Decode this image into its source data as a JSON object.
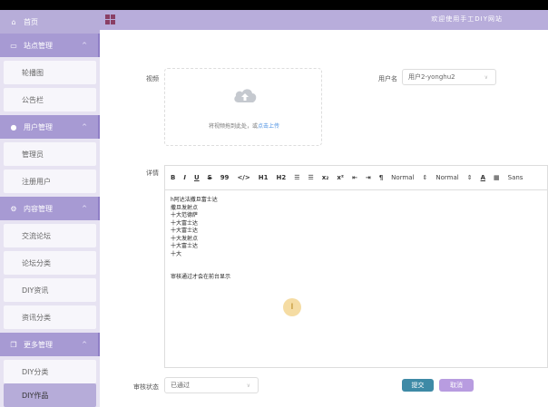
{
  "header": {
    "title": "欢迎使用手工DIY网站",
    "menu_icon": "grid-menu-icon"
  },
  "sidebar": {
    "home": {
      "label": "首页",
      "icon": "home-icon"
    },
    "groups": [
      {
        "label": "站点管理",
        "icon": "monitor-icon",
        "items": [
          "轮播图",
          "公告栏"
        ]
      },
      {
        "label": "用户管理",
        "icon": "user-icon",
        "items": [
          "管理员",
          "注册用户"
        ]
      },
      {
        "label": "内容管理",
        "icon": "gear-icon",
        "items": [
          "交流论坛",
          "论坛分类",
          "DIY资讯",
          "资讯分类"
        ]
      },
      {
        "label": "更多管理",
        "icon": "stack-icon",
        "items": [
          "DIY分类",
          "DIY作品"
        ]
      }
    ],
    "active_item": "DIY作品"
  },
  "form": {
    "video_label": "视频",
    "upload_text": "将视频拖到此处，或",
    "upload_link": "点击上传",
    "username_label": "用户名",
    "username_value": "用户2-yonghu2",
    "detail_label": "详情",
    "audit_label": "审核状态",
    "audit_value": "已通过",
    "submit_label": "提交",
    "cancel_label": "取消"
  },
  "editor": {
    "toolbar": [
      "B",
      "I",
      "U",
      "S",
      "99",
      "</>",
      "H1",
      "H2",
      "☰",
      "☰",
      "x₂",
      "x²",
      "⇤",
      "⇥",
      "¶",
      "Normal",
      "⇕",
      "Normal",
      "⇕",
      "A",
      "▦",
      "Sans"
    ],
    "lines": [
      "h阿达法撒旦富士达",
      "撒旦发射点",
      "十大范德萨",
      "十大富士达",
      "十大富士达",
      "十大发射点",
      "十大富士达",
      "十大",
      "",
      "",
      "审核通过才会在前台显示"
    ]
  },
  "colors": {
    "accent": "#a79ad3",
    "submit": "#3e8aa6",
    "cancel": "#b89ce0"
  }
}
